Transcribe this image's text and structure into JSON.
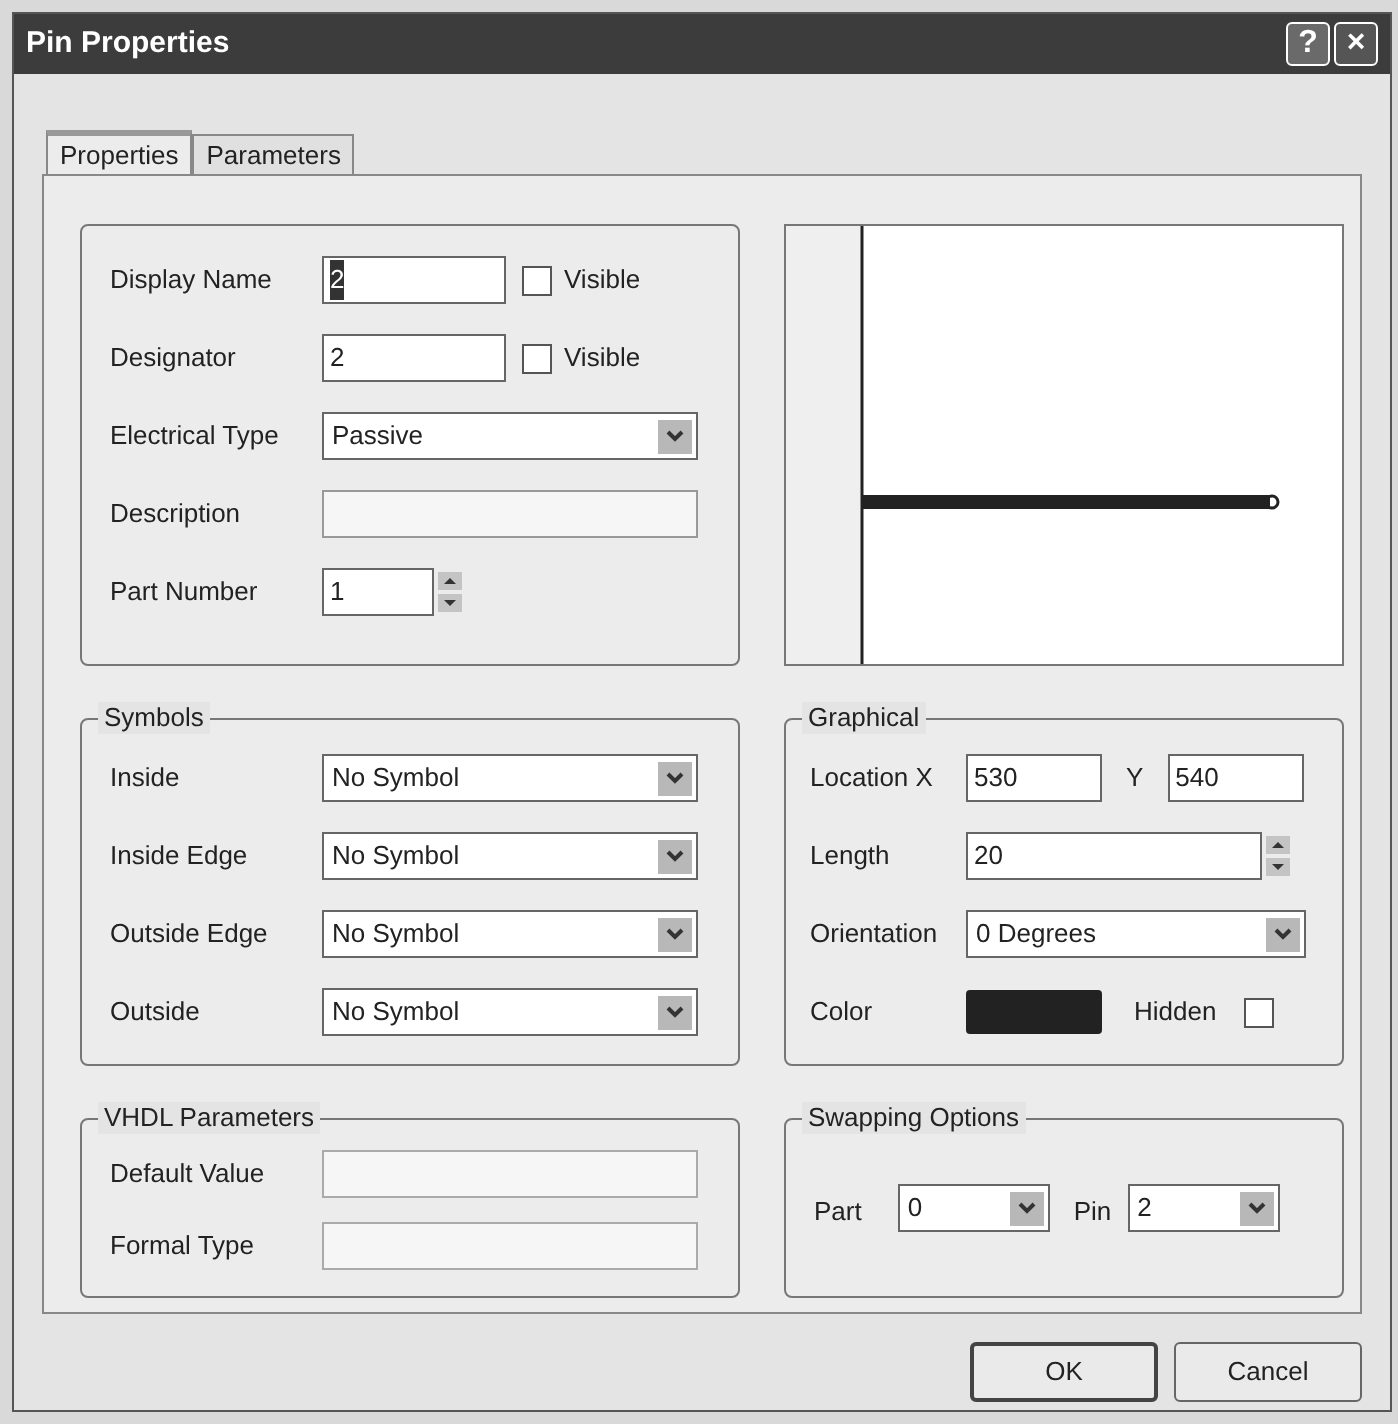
{
  "window": {
    "title": "Pin Properties",
    "title_buttons": [
      {
        "kind": "help",
        "label": "?"
      },
      {
        "kind": "close",
        "label": "×"
      }
    ]
  },
  "tabs": [
    {
      "label": "Properties",
      "selected": true
    },
    {
      "label": "Parameters",
      "selected": false
    }
  ],
  "pin_fields": [
    {
      "kind": "text",
      "label": "Display Name",
      "value": "2",
      "selected_text": true,
      "visible_label": "Visible",
      "visible": false
    },
    {
      "kind": "text",
      "label": "Designator",
      "value": "2",
      "selected_text": false,
      "visible_label": "Visible",
      "visible": false
    },
    {
      "kind": "combo",
      "label": "Electrical Type",
      "value": "Passive"
    },
    {
      "kind": "disabled",
      "label": "Description"
    },
    {
      "kind": "spin",
      "label": "Part Number",
      "value": "1"
    }
  ],
  "symbols": {
    "title": "Symbols",
    "rows": [
      {
        "label": "Inside",
        "value": "No Symbol"
      },
      {
        "label": "Inside Edge",
        "value": "No Symbol"
      },
      {
        "label": "Outside Edge",
        "value": "No Symbol"
      },
      {
        "label": "Outside",
        "value": "No Symbol"
      }
    ]
  },
  "graphical": {
    "title": "Graphical",
    "location_label": "Location X",
    "x_value": "530",
    "y_label": "Y",
    "y_value": "540",
    "length_label": "Length",
    "length_value": "20",
    "orientation_label": "Orientation",
    "orientation_value": "0 Degrees",
    "color_label": "Color",
    "color": "#222222",
    "hidden_label": "Hidden",
    "hidden": false
  },
  "vhdl": {
    "title": "VHDL Parameters",
    "rows": [
      {
        "label": "Default Value",
        "disabled": true
      },
      {
        "label": "Formal Type",
        "disabled": true
      }
    ]
  },
  "swapping": {
    "title": "Swapping Options",
    "part_label": "Part",
    "part_value": "0",
    "pin_label": "Pin",
    "pin_value": "2"
  },
  "buttons": [
    {
      "label": "OK",
      "default": true
    },
    {
      "label": "Cancel",
      "default": false
    }
  ]
}
